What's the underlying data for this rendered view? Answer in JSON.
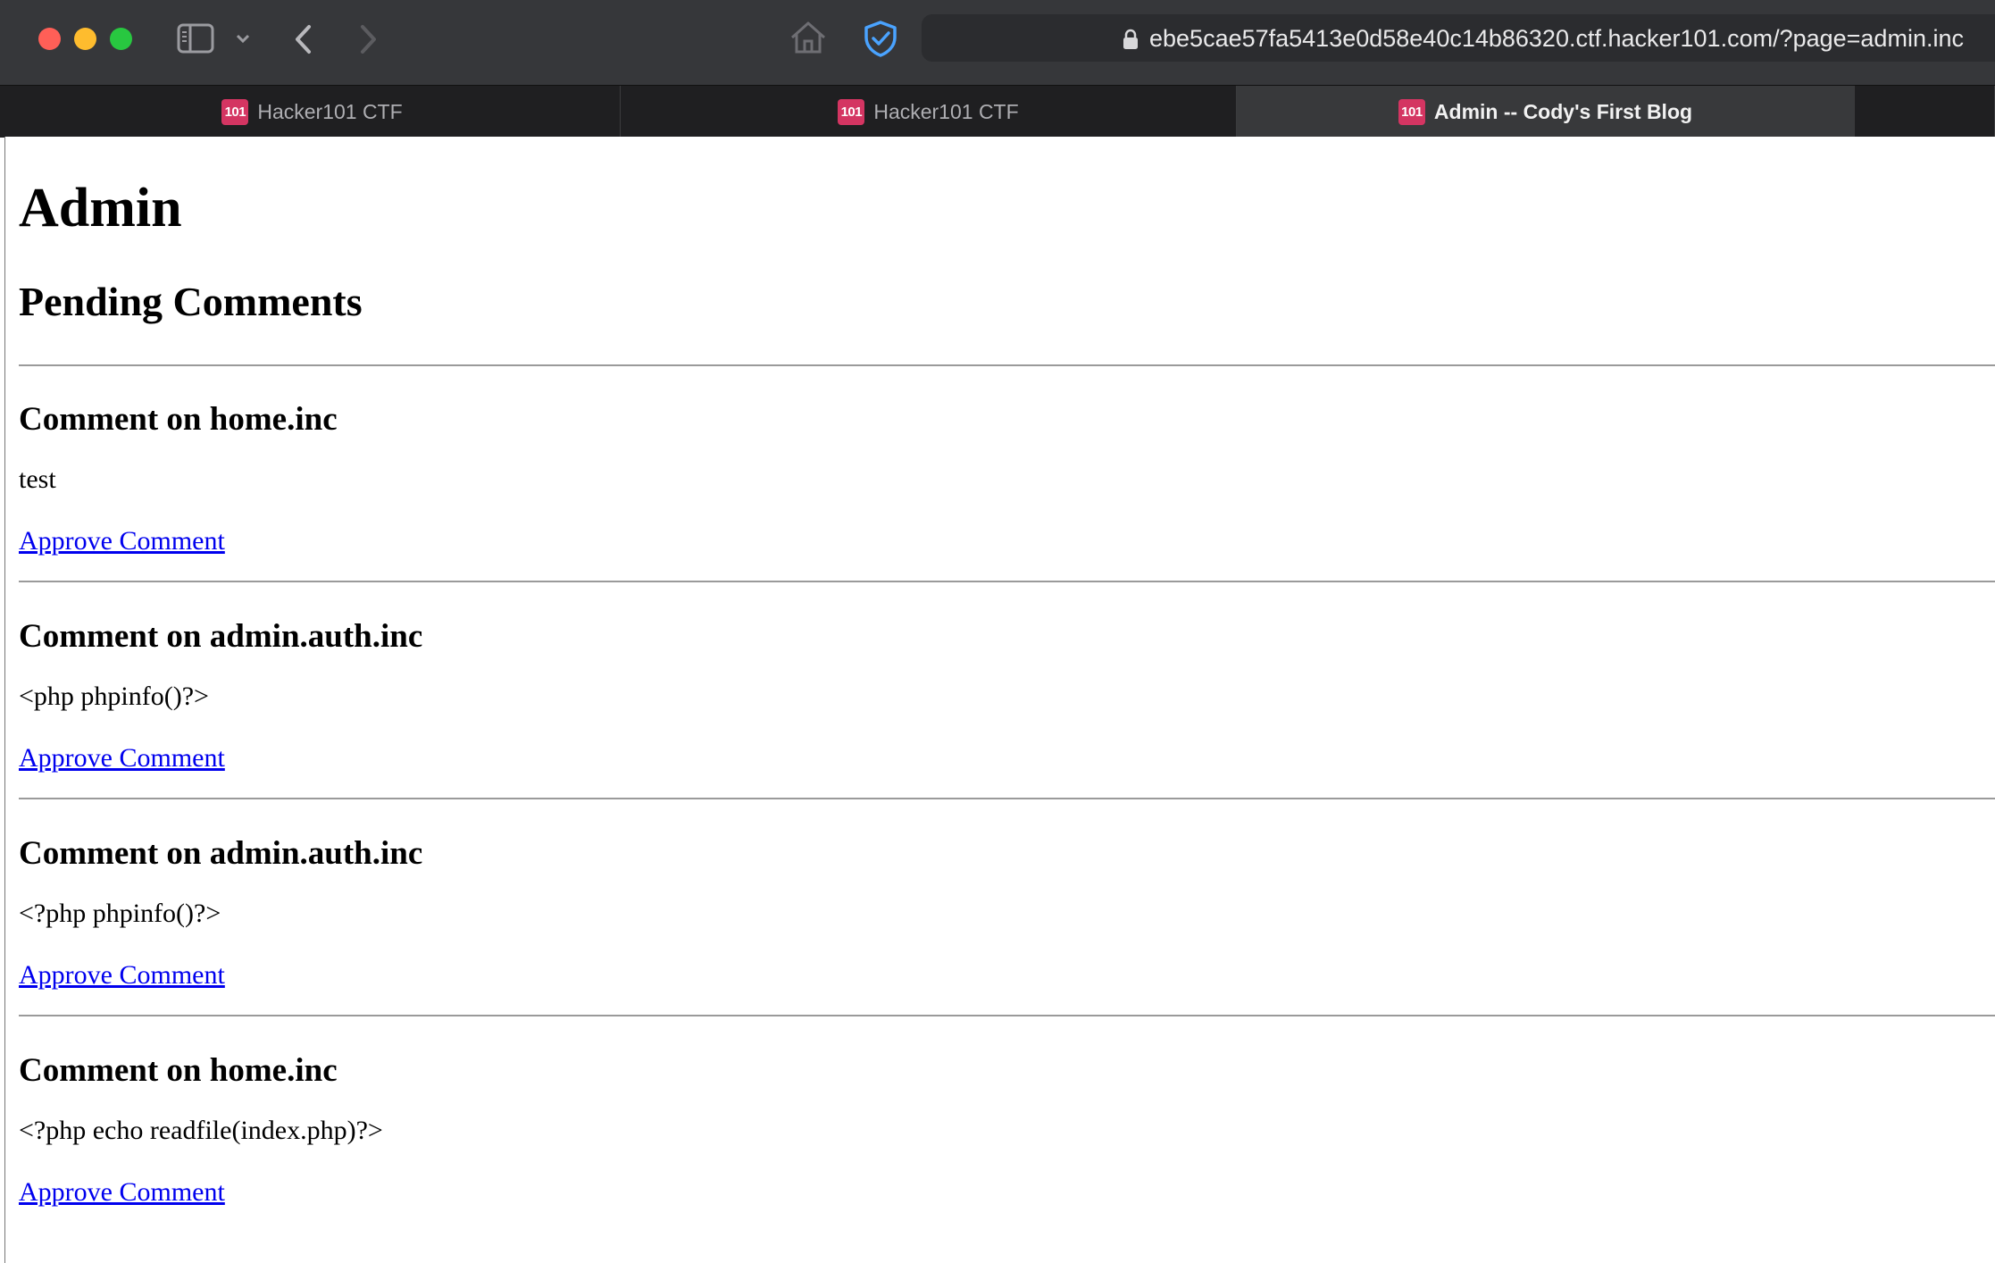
{
  "browser": {
    "url": "ebe5cae57fa5413e0d58e40c14b86320.ctf.hacker101.com/?page=admin.inc",
    "tabs": [
      {
        "label": "Hacker101 CTF",
        "favicon": "101",
        "active": false
      },
      {
        "label": "Hacker101 CTF",
        "favicon": "101",
        "active": false
      },
      {
        "label": "Admin -- Cody's First Blog",
        "favicon": "101",
        "active": true
      }
    ],
    "colors": {
      "toolbar": "#36373a",
      "tabbar": "#1f1f21",
      "favicon": "#d43562",
      "shield": "#4aa3ff"
    }
  },
  "page": {
    "title": "Admin",
    "section_title": "Pending Comments",
    "comments": [
      {
        "heading": "Comment on home.inc",
        "body": "test",
        "action": "Approve Comment"
      },
      {
        "heading": "Comment on admin.auth.inc",
        "body": "<php phpinfo()?>",
        "action": "Approve Comment"
      },
      {
        "heading": "Comment on admin.auth.inc",
        "body": "<?php phpinfo()?>",
        "action": "Approve Comment"
      },
      {
        "heading": "Comment on home.inc",
        "body": "<?php echo readfile(index.php)?>",
        "action": "Approve Comment"
      }
    ],
    "link_color": "#0000ee"
  }
}
